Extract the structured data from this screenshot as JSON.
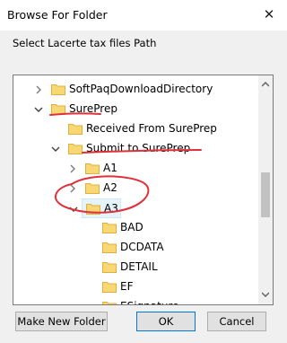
{
  "window": {
    "title": "Browse For Folder",
    "close_glyph": "✕"
  },
  "prompt": "Select Lacerte tax files Path",
  "tree": {
    "items": [
      {
        "label": "SoftPaqDownloadDirectory",
        "depth": 0,
        "arrow": "collapsed",
        "selected": false
      },
      {
        "label": "SurePrep",
        "depth": 0,
        "arrow": "expanded",
        "selected": false
      },
      {
        "label": "Received From SurePrep",
        "depth": 1,
        "arrow": "none",
        "selected": false
      },
      {
        "label": "Submit to SurePrep",
        "depth": 1,
        "arrow": "expanded",
        "selected": false
      },
      {
        "label": "A1",
        "depth": 2,
        "arrow": "collapsed",
        "selected": false
      },
      {
        "label": "A2",
        "depth": 2,
        "arrow": "collapsed",
        "selected": false
      },
      {
        "label": "A3",
        "depth": 2,
        "arrow": "expanded",
        "selected": true
      },
      {
        "label": "BAD",
        "depth": 3,
        "arrow": "none",
        "selected": false
      },
      {
        "label": "DCDATA",
        "depth": 3,
        "arrow": "none",
        "selected": false
      },
      {
        "label": "DETAIL",
        "depth": 3,
        "arrow": "none",
        "selected": false
      },
      {
        "label": "EF",
        "depth": 3,
        "arrow": "none",
        "selected": false
      },
      {
        "label": "ESignature",
        "depth": 3,
        "arrow": "none",
        "selected": false
      }
    ]
  },
  "buttons": {
    "new_folder": "Make New Folder",
    "ok": "OK",
    "cancel": "Cancel"
  },
  "colors": {
    "folder": "#f8d775",
    "folder_dark": "#e0b03f",
    "annotation": "#e0313a",
    "selection": "#e5f3fb"
  },
  "icons": {
    "folder": "folder-icon",
    "expand": "chevron-right-icon",
    "collapse": "chevron-down-icon"
  }
}
